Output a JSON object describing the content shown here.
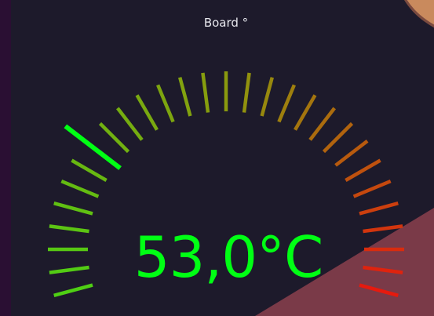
{
  "widget": {
    "title": "Board °",
    "reading": "53,0°C"
  },
  "gauge": {
    "value": 53.0,
    "unit": "°C",
    "tick_count": 29,
    "active_tick_index": 7
  },
  "colors": {
    "panel_background": "#1d1a2b",
    "title_text": "#e8e8ee",
    "reading_text": "#00ff14",
    "active_tick": "#00ff14",
    "scale_start": "#4fcf14",
    "scale_mid": "#8a9a0e",
    "scale_end": "#e61a0e"
  }
}
